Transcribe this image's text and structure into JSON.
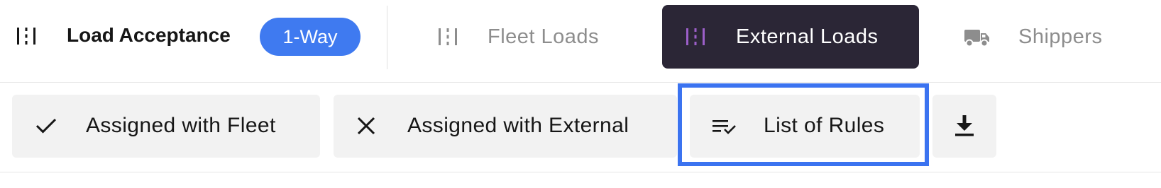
{
  "app": {
    "title": "Load Acceptance",
    "icon": "grid-lines-icon",
    "mode_badge": "1-Way"
  },
  "nav_tabs": [
    {
      "label": "Fleet Loads",
      "icon": "grid-lines-icon",
      "active": false
    },
    {
      "label": "External Loads",
      "icon": "grid-lines-icon",
      "active": true
    },
    {
      "label": "Shippers",
      "icon": "truck-icon",
      "active": false
    }
  ],
  "actions": [
    {
      "label": "Assigned with Fleet",
      "icon": "checkmark-icon"
    },
    {
      "label": "Assigned with External",
      "icon": "close-icon"
    },
    {
      "label": "List of Rules",
      "icon": "list-check-icon",
      "focused": true
    },
    {
      "label": "",
      "icon": "download-icon"
    }
  ],
  "colors": {
    "accent_blue": "#3f7af0",
    "focus_ring": "#3b73f0",
    "active_tab_bg": "#2b2636",
    "active_tab_icon": "#9c5fc9",
    "inactive_text": "#8d8d8d",
    "button_bg": "#f2f2f2"
  }
}
